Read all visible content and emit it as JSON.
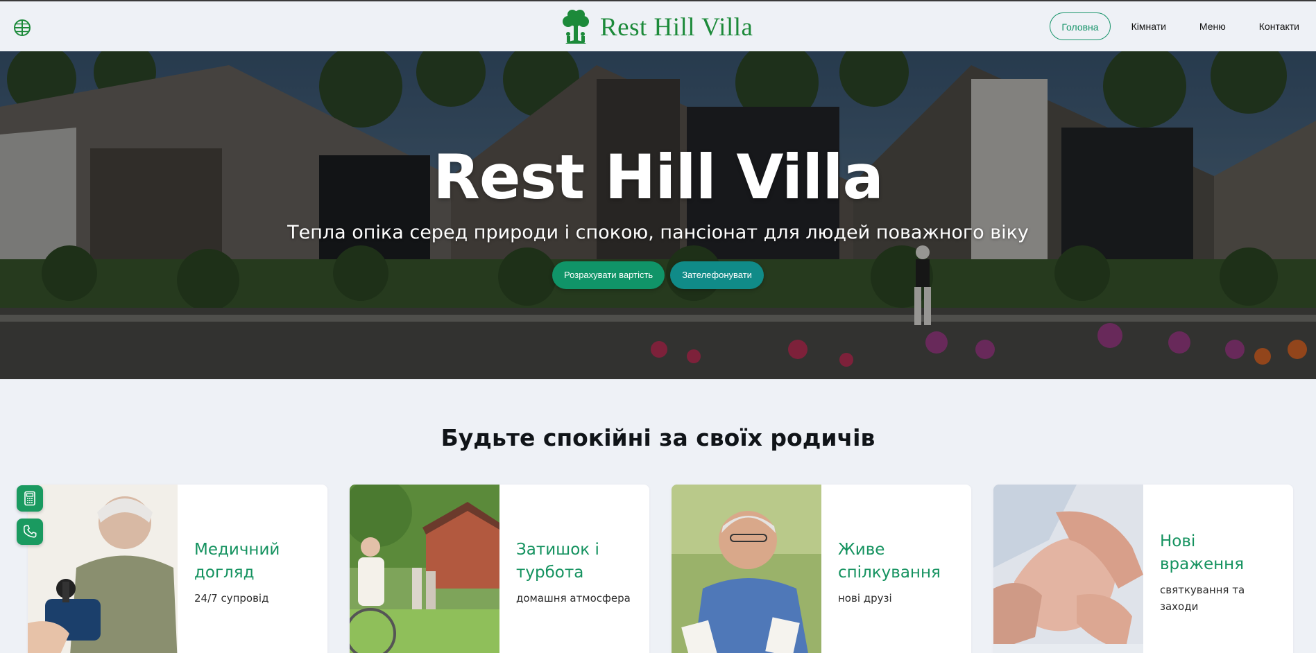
{
  "header": {
    "logo_text": "Rest Hill Villa",
    "nav": [
      {
        "label": "Головна",
        "active": true
      },
      {
        "label": "Кімнати",
        "active": false
      },
      {
        "label": "Меню",
        "active": false
      },
      {
        "label": "Контакти",
        "active": false
      }
    ],
    "icons": {
      "language": "globe-icon",
      "logo": "tree-logo-icon"
    }
  },
  "hero": {
    "title": "Rest Hill Villa",
    "subtitle": "Тепла опіка серед природи і спокою, пансіонат для людей поважного віку",
    "buttons": {
      "calculate": "Розрахувати вартість",
      "call": "Зателефонувати"
    }
  },
  "section": {
    "title": "Будьте спокійні за своїх родичів",
    "cards": [
      {
        "title": "Медичний догляд",
        "text": "24/7 супровід",
        "image": "elderly-woman-blood-pressure"
      },
      {
        "title": "Затишок і турбота",
        "text": "домашня атмосфера",
        "image": "elderly-garden-walk"
      },
      {
        "title": "Живе спілкування",
        "text": "нові друзі",
        "image": "elderly-man-playing-cards"
      },
      {
        "title": "Нові враження",
        "text": "святкування та заходи",
        "image": "holding-hands"
      }
    ]
  },
  "floating": {
    "calculator_icon": "calculator-icon",
    "phone_icon": "phone-icon"
  },
  "colors": {
    "brand_green": "#1c8a3a",
    "accent_green": "#109468",
    "teal": "#108b88",
    "page_bg": "#eef1f6"
  }
}
